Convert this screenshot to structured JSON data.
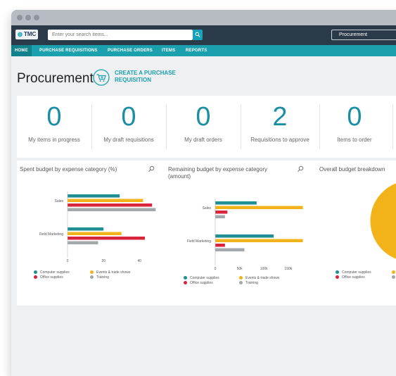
{
  "window": {
    "dots": [
      "red-dot",
      "yellow-dot",
      "green-dot"
    ]
  },
  "topbar": {
    "logo_text": "TMC",
    "search_placeholder": "Enter your search items...",
    "app_selector": "Procurement"
  },
  "nav": {
    "items": [
      "HOME",
      "PURCHASE REQUISITIONS",
      "PURCHASE ORDERS",
      "ITEMS",
      "REPORTS"
    ],
    "active_index": 0
  },
  "page": {
    "title": "Procurement",
    "create_label_line1": "CREATE A PURCHASE",
    "create_label_line2": "REQUISITION"
  },
  "stats": [
    {
      "value": "0",
      "label": "My items in progress"
    },
    {
      "value": "0",
      "label": "My draft requisitions"
    },
    {
      "value": "0",
      "label": "My draft orders"
    },
    {
      "value": "2",
      "label": "Requisitions to approve"
    },
    {
      "value": "0",
      "label": "Items to order"
    }
  ],
  "colors": {
    "computer_supplies": "#1f8f93",
    "events_trade_shows": "#f2b21a",
    "office_supplies": "#d8253b",
    "training": "#a3a8ad",
    "accent": "#1aa1ad"
  },
  "chart_data": [
    {
      "type": "bar",
      "orientation": "horizontal",
      "title": "Spent budget by expense category (%)",
      "categories": [
        "Sales",
        "Field Marketing"
      ],
      "series": [
        {
          "name": "Computer supplies",
          "values": [
            29,
            20
          ]
        },
        {
          "name": "Events & trade shows",
          "values": [
            42,
            30
          ]
        },
        {
          "name": "Office supplies",
          "values": [
            47,
            43
          ]
        },
        {
          "name": "Training",
          "values": [
            49,
            17
          ]
        }
      ],
      "xticks": [
        "0",
        "20",
        "40"
      ],
      "xlim": [
        0,
        52
      ],
      "legend": "bottom"
    },
    {
      "type": "bar",
      "orientation": "horizontal",
      "title_line1": "Remaining budget by expense category",
      "title_line2": "(amount)",
      "categories": [
        "Sales",
        "Field Marketing"
      ],
      "series": [
        {
          "name": "Computer supplies",
          "values": [
            85000,
            120000
          ]
        },
        {
          "name": "Events & trade shows",
          "values": [
            180000,
            180000
          ]
        },
        {
          "name": "Office supplies",
          "values": [
            25000,
            20000
          ]
        },
        {
          "name": "Training",
          "values": [
            20000,
            60000
          ]
        }
      ],
      "xticks": [
        "0",
        "50k",
        "100k",
        "150k"
      ],
      "xlim": [
        0,
        195000
      ],
      "legend": "bottom"
    },
    {
      "type": "pie",
      "title": "Overall budget breakdown",
      "series": [
        {
          "name": "Computer supplies",
          "values": [
            8
          ]
        },
        {
          "name": "Events & trade shows",
          "values": [
            62
          ]
        },
        {
          "name": "Office supplies",
          "values": [
            20
          ]
        },
        {
          "name": "Training",
          "values": [
            10
          ]
        }
      ],
      "legend_visible": [
        "Computer supplies",
        "Office supplies"
      ]
    }
  ]
}
